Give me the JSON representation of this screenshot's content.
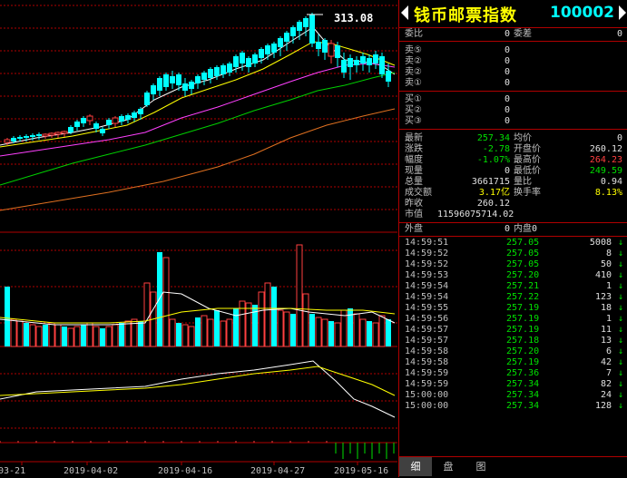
{
  "header": {
    "title": "钱币邮票指数",
    "code": "100002"
  },
  "chart_data": {
    "type": "candlestick",
    "peak_label": "313.08",
    "x_ticks": [
      "03-21",
      "2019-04-02",
      "2019-04-16",
      "2019-04-27",
      "2019-05-16"
    ]
  },
  "order_book": {
    "weibi_label": "委比",
    "weibi_value": "0",
    "weicha_label": "委差",
    "weicha_value": "0",
    "sell": [
      {
        "label": "卖⑤",
        "value": "0"
      },
      {
        "label": "卖②",
        "value": "0"
      },
      {
        "label": "卖②",
        "value": "0"
      },
      {
        "label": "卖①",
        "value": "0"
      }
    ],
    "buy": [
      {
        "label": "买①",
        "value": "0"
      },
      {
        "label": "买②",
        "value": "0"
      },
      {
        "label": "买③",
        "value": "0"
      }
    ]
  },
  "quote": {
    "rows": [
      {
        "l1": "最新",
        "v1": "257.34",
        "c1": "g",
        "l2": "均价",
        "v2": "0",
        "c2": "w"
      },
      {
        "l1": "涨跌",
        "v1": "-2.78",
        "c1": "g",
        "l2": "开盘价",
        "v2": "260.12",
        "c2": "w"
      },
      {
        "l1": "幅度",
        "v1": "-1.07%",
        "c1": "g",
        "l2": "最高价",
        "v2": "264.23",
        "c2": "r"
      },
      {
        "l1": "现量",
        "v1": "0",
        "c1": "w",
        "l2": "最低价",
        "v2": "249.59",
        "c2": "g"
      },
      {
        "l1": "总量",
        "v1": "3661715",
        "c1": "w",
        "l2": "量比",
        "v2": "0.94",
        "c2": "w"
      },
      {
        "l1": "成交额",
        "v1": "3.17亿",
        "c1": "y",
        "l2": "换手率",
        "v2": "8.13%",
        "c2": "y"
      }
    ],
    "zuoshou_label": "昨收",
    "zuoshou_value": "260.12",
    "shizhi_label": "市值",
    "shizhi_value": "11596075714.02"
  },
  "disk": {
    "outer_label": "外盘",
    "outer_value": "0",
    "inner_label": "内盘",
    "inner_value": "0"
  },
  "ticks": [
    {
      "time": "14:59:51",
      "price": "257.05",
      "vol": "5008"
    },
    {
      "time": "14:59:52",
      "price": "257.05",
      "vol": "8"
    },
    {
      "time": "14:59:52",
      "price": "257.05",
      "vol": "50"
    },
    {
      "time": "14:59:53",
      "price": "257.20",
      "vol": "410"
    },
    {
      "time": "14:59:54",
      "price": "257.21",
      "vol": "1"
    },
    {
      "time": "14:59:54",
      "price": "257.22",
      "vol": "123"
    },
    {
      "time": "14:59:55",
      "price": "257.19",
      "vol": "18"
    },
    {
      "time": "14:59:56",
      "price": "257.19",
      "vol": "1"
    },
    {
      "time": "14:59:57",
      "price": "257.19",
      "vol": "11"
    },
    {
      "time": "14:59:57",
      "price": "257.18",
      "vol": "13"
    },
    {
      "time": "14:59:58",
      "price": "257.20",
      "vol": "6"
    },
    {
      "time": "14:59:58",
      "price": "257.19",
      "vol": "42"
    },
    {
      "time": "14:59:59",
      "price": "257.36",
      "vol": "7"
    },
    {
      "time": "14:59:59",
      "price": "257.34",
      "vol": "82"
    },
    {
      "time": "15:00:00",
      "price": "257.34",
      "vol": "24"
    },
    {
      "time": "15:00:00",
      "price": "257.34",
      "vol": "128"
    }
  ],
  "tick_arrow": "↓",
  "tabs": [
    "细",
    "盘",
    "图"
  ],
  "colors": {
    "up": "#ff4040",
    "down": "#00ffff",
    "ma5": "#ffffff",
    "ma10": "#ffff00",
    "ma20": "#ff40ff",
    "ma30": "#00d000",
    "ma60": "#e07020",
    "grid": "#b00000"
  }
}
